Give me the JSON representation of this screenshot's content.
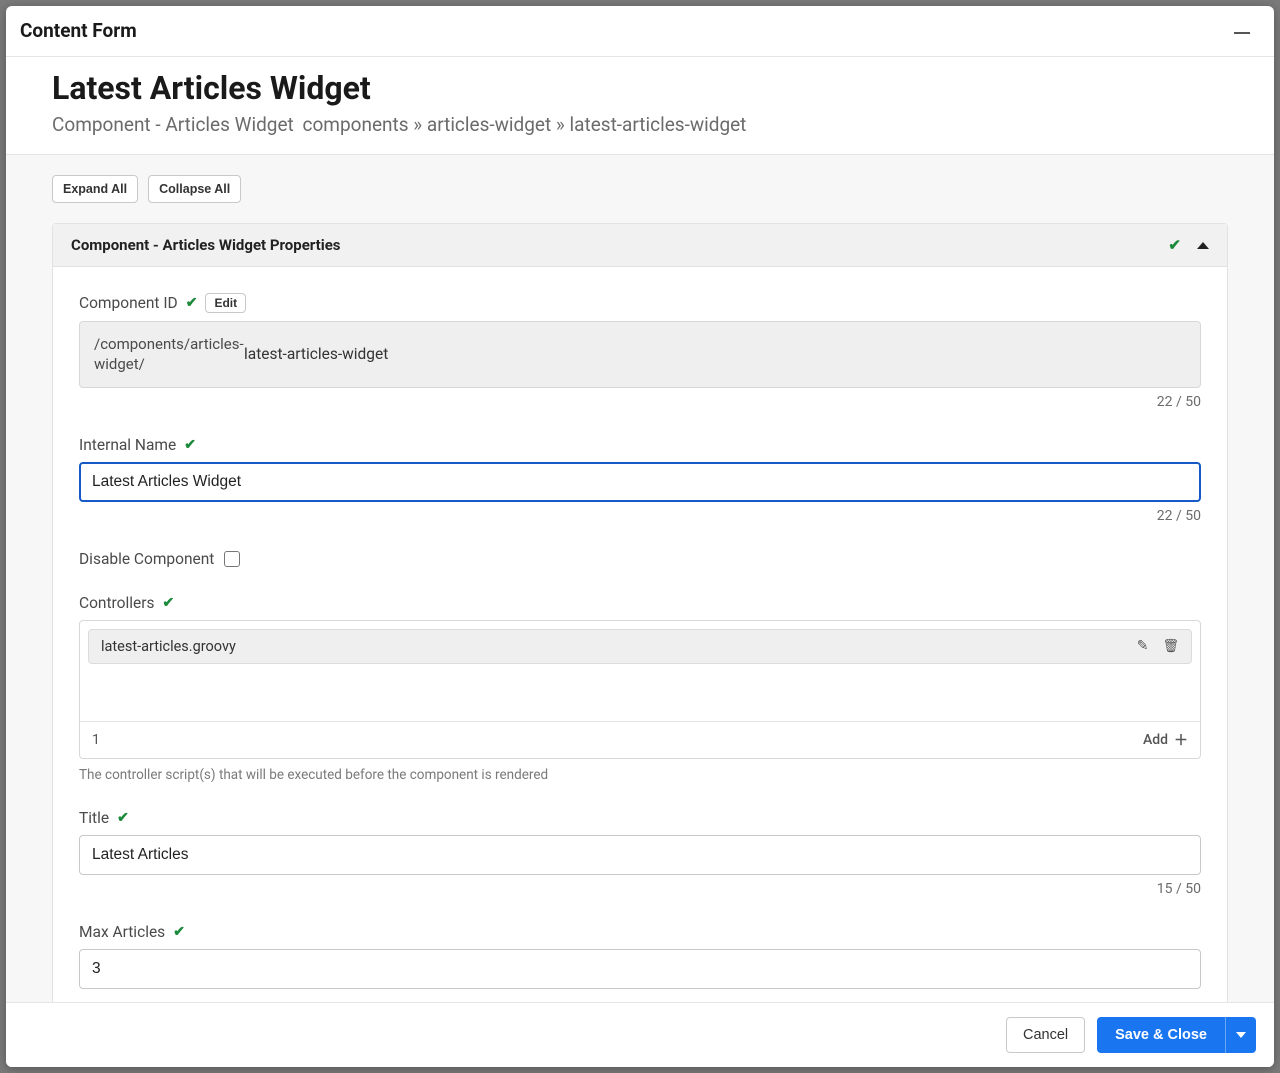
{
  "dialog": {
    "title": "Content Form"
  },
  "page": {
    "title": "Latest Articles Widget",
    "componentType": "Component - Articles Widget",
    "breadcrumb": "components » articles-widget » latest-articles-widget"
  },
  "toolbar": {
    "expandAll": "Expand All",
    "collapseAll": "Collapse All"
  },
  "section": {
    "title": "Component - Articles Widget Properties"
  },
  "fields": {
    "componentId": {
      "label": "Component ID",
      "editLabel": "Edit",
      "prefix": "/components/articles-widget/",
      "value": "latest-articles-widget",
      "count": "22 / 50"
    },
    "internalName": {
      "label": "Internal Name",
      "value": "Latest Articles Widget",
      "count": "22 / 50"
    },
    "disableComponent": {
      "label": "Disable Component",
      "checked": false
    },
    "controllers": {
      "label": "Controllers",
      "items": [
        {
          "name": "latest-articles.groovy"
        }
      ],
      "count": "1",
      "addLabel": "Add",
      "helper": "The controller script(s) that will be executed before the component is rendered"
    },
    "title": {
      "label": "Title",
      "value": "Latest Articles",
      "count": "15 / 50"
    },
    "maxArticles": {
      "label": "Max Articles",
      "value": "3"
    }
  },
  "footer": {
    "cancel": "Cancel",
    "saveClose": "Save & Close"
  }
}
